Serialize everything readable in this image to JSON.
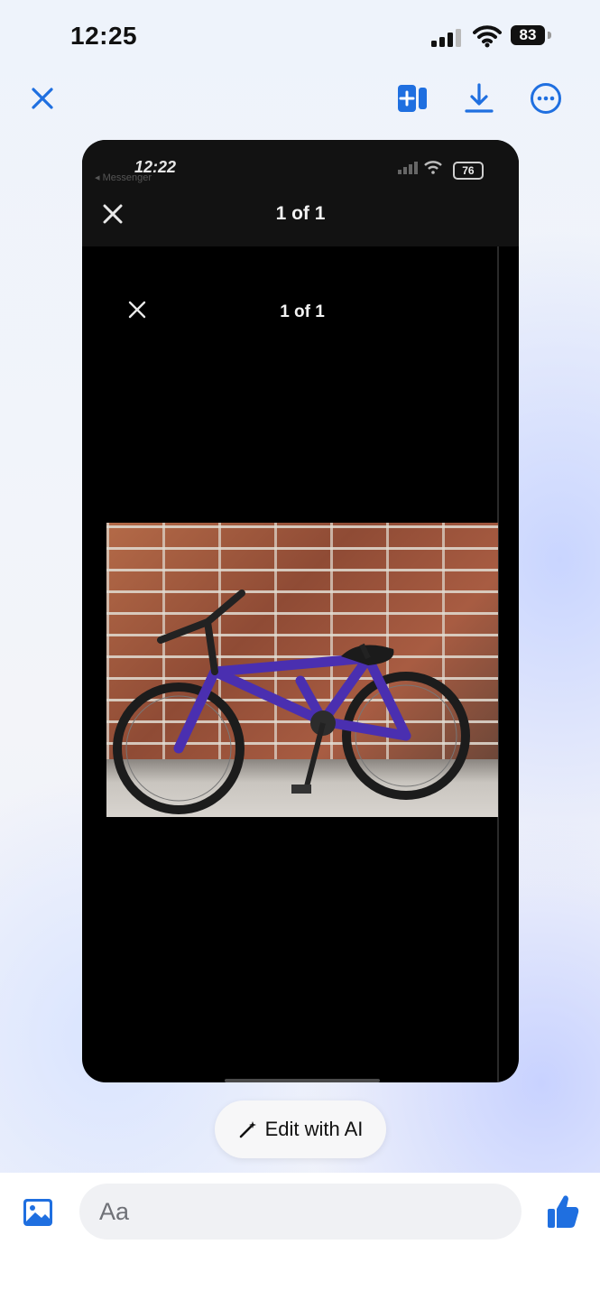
{
  "status_bar": {
    "time": "12:25",
    "battery": "83"
  },
  "top_bar": {
    "close_icon": "close-icon",
    "side_by_side_icon": "add-to-story-icon",
    "download_icon": "download-icon",
    "more_icon": "more-options-icon",
    "accent_color": "#1f6fe0"
  },
  "screenshot": {
    "mini_time": "12:22",
    "mini_back": "◂ Messenger",
    "mini_battery": "76",
    "count_top": "1 of 1",
    "count_inner": "1 of 1"
  },
  "edit_ai": {
    "label": "Edit with AI"
  },
  "composer": {
    "placeholder": "Aa",
    "gallery_icon": "gallery-icon",
    "like_icon": "thumbs-up-icon"
  }
}
